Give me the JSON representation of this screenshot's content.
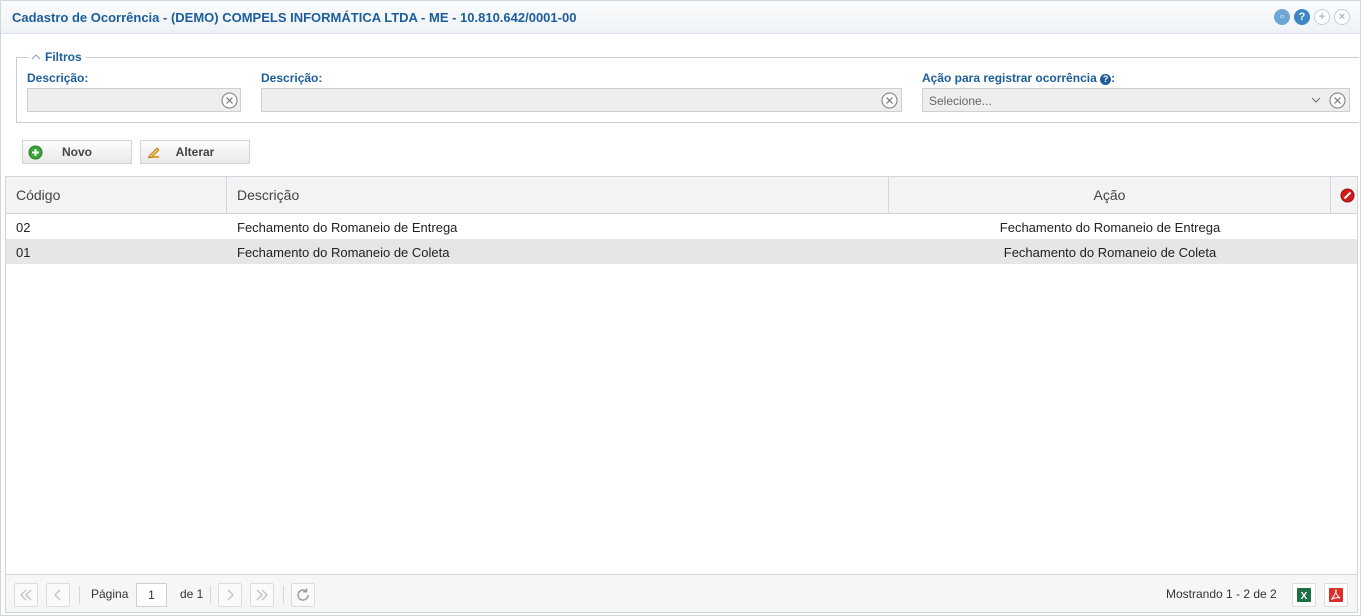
{
  "window": {
    "title": "Cadastro de Ocorrência - (DEMO) COMPELS INFORMÁTICA LTDA - ME - 10.810.642/0001-00"
  },
  "filters": {
    "legend": "Filtros",
    "field1_label": "Descrição:",
    "field1_value": "",
    "field2_label": "Descrição:",
    "field2_value": "",
    "field3_label": "Ação para registrar ocorrência",
    "field3_help": "?",
    "field3_suffix": ":",
    "field3_placeholder": "Selecione..."
  },
  "toolbar": {
    "new_label": "Novo",
    "edit_label": "Alterar"
  },
  "grid": {
    "columns": [
      "Código",
      "Descrição",
      "Ação"
    ],
    "rows": [
      {
        "codigo": "02",
        "descricao": "Fechamento do Romaneio de Entrega",
        "acao": "Fechamento do Romaneio de Entrega"
      },
      {
        "codigo": "01",
        "descricao": "Fechamento do Romaneio de Coleta",
        "acao": "Fechamento do Romaneio de Coleta"
      }
    ]
  },
  "pager": {
    "page_label": "Página",
    "page_value": "1",
    "of_label": "de 1",
    "showing": "Mostrando 1 - 2 de 2"
  },
  "colors": {
    "title_blue": "#1c5e9b",
    "alt_row": "#e6e6e6"
  }
}
